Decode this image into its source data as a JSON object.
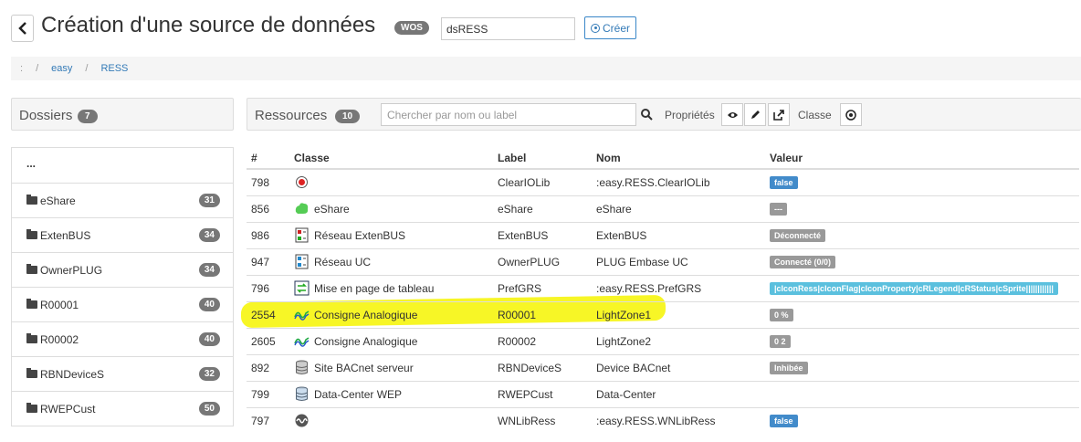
{
  "header": {
    "title": "Création d'une source de données",
    "badge": "WOS",
    "name_value": "dsRESS",
    "create_label": "Créer"
  },
  "breadcrumb": {
    "root": ":",
    "sep": "/",
    "items": [
      "easy",
      "RESS"
    ]
  },
  "folders_panel": {
    "title": "Dossiers",
    "count": "7",
    "items": [
      {
        "label": "eShare",
        "count": "31"
      },
      {
        "label": "ExtenBUS",
        "count": "34"
      },
      {
        "label": "OwnerPLUG",
        "count": "34"
      },
      {
        "label": "R00001",
        "count": "40"
      },
      {
        "label": "R00002",
        "count": "40"
      },
      {
        "label": "RBNDeviceS",
        "count": "32"
      },
      {
        "label": "RWEPCust",
        "count": "50"
      }
    ],
    "parent": "..."
  },
  "resources_panel": {
    "title": "Ressources",
    "count": "10",
    "search_placeholder": "Chercher par nom ou label",
    "props_label": "Propriétés",
    "class_label": "Classe"
  },
  "table": {
    "headers": [
      "#",
      "Classe",
      "Label",
      "Nom",
      "Valeur"
    ],
    "rows": [
      {
        "id": "798",
        "classe": "",
        "icon": "red-dot-icon",
        "label": "ClearIOLib",
        "nom": ":easy.RESS.ClearIOLib",
        "valeur": "false",
        "vcolor": "#428bca"
      },
      {
        "id": "856",
        "classe": "eShare",
        "icon": "eshare-icon",
        "label": "eShare",
        "nom": "eShare",
        "valeur": "---",
        "vcolor": "#999999"
      },
      {
        "id": "986",
        "classe": "Réseau ExtenBUS",
        "icon": "extenbus-icon",
        "label": "ExtenBUS",
        "nom": "ExtenBUS",
        "valeur": "Déconnecté",
        "vcolor": "#999999"
      },
      {
        "id": "947",
        "classe": "Réseau UC",
        "icon": "network-uc-icon",
        "label": "OwnerPLUG",
        "nom": "PLUG Embase UC",
        "valeur": "Connecté (0/0)",
        "vcolor": "#999999"
      },
      {
        "id": "796",
        "classe": "Mise en page de tableau",
        "icon": "table-layout-icon",
        "label": "PrefGRS",
        "nom": ":easy.RESS.PrefGRS",
        "valeur": "|cIconRess|cIconFlag|cIconProperty|cRLegend|cRStatus|cSprite||||||||||||",
        "vcolor": "#5bc0de"
      },
      {
        "id": "2554",
        "classe": "Consigne Analogique",
        "icon": "analog-icon",
        "label": "R00001",
        "nom": "LightZone1",
        "valeur": "0 %",
        "vcolor": "#999999"
      },
      {
        "id": "2605",
        "classe": "Consigne Analogique",
        "icon": "analog-icon",
        "label": "R00002",
        "nom": "LightZone2",
        "valeur": "0 2",
        "vcolor": "#999999"
      },
      {
        "id": "892",
        "classe": "Site BACnet serveur",
        "icon": "database-icon",
        "label": "RBNDeviceS",
        "nom": "Device BACnet",
        "valeur": "Inhibée",
        "vcolor": "#999999"
      },
      {
        "id": "799",
        "classe": "Data-Center WEP",
        "icon": "datacenter-icon",
        "label": "RWEPCust",
        "nom": "Data-Center",
        "valeur": "",
        "vcolor": ""
      },
      {
        "id": "797",
        "classe": "",
        "icon": "wnlib-icon",
        "label": "WNLibRess",
        "nom": ":easy.RESS.WNLibRess",
        "valeur": "false",
        "vcolor": "#428bca"
      }
    ]
  },
  "colors": {
    "highlight": "#f6f500",
    "link": "#337ab7",
    "badge": "#777777"
  }
}
